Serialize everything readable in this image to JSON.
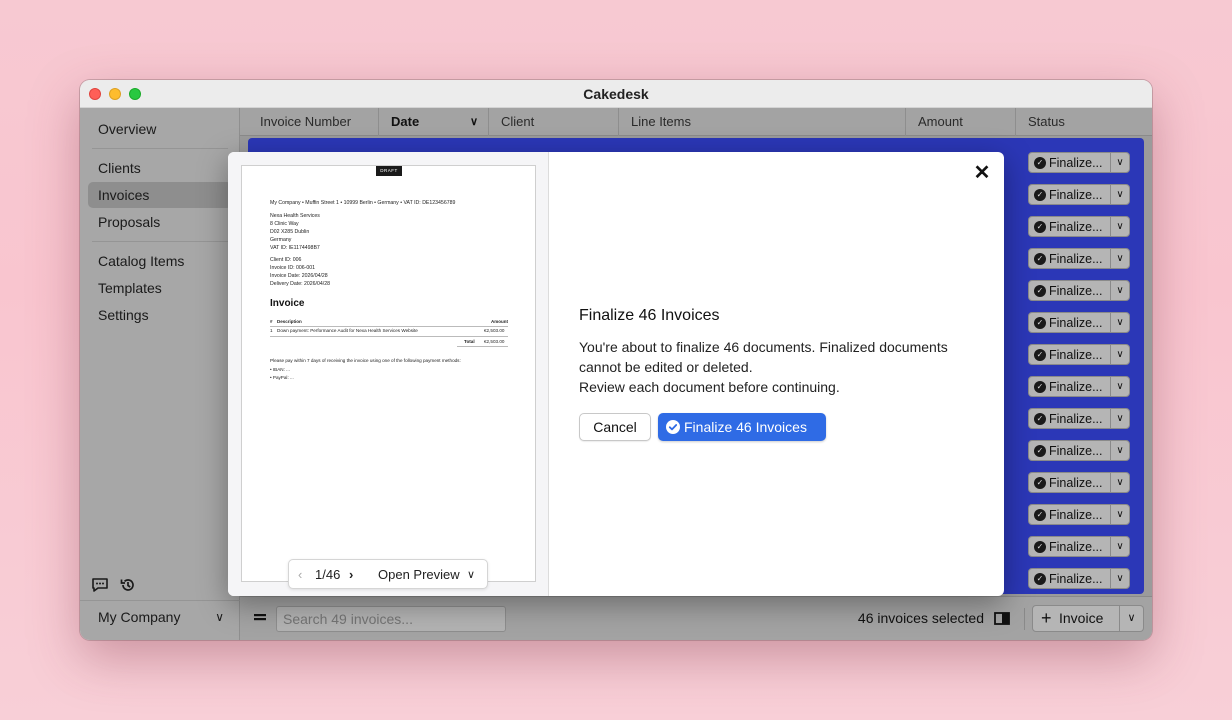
{
  "window": {
    "title": "Cakedesk"
  },
  "sidebar": {
    "items": [
      {
        "label": "Overview"
      },
      {
        "label": "Clients"
      },
      {
        "label": "Invoices"
      },
      {
        "label": "Proposals"
      },
      {
        "label": "Catalog Items"
      },
      {
        "label": "Templates"
      },
      {
        "label": "Settings"
      }
    ],
    "active": "Invoices",
    "company": "My Company"
  },
  "table": {
    "columns": [
      "Invoice Number",
      "Date",
      "Client",
      "Line Items",
      "Amount",
      "Status"
    ],
    "sorted_column": "Date",
    "status_label": "Finalize...",
    "visible_status_rows": 14
  },
  "bottombar": {
    "search_placeholder": "Search 49 invoices...",
    "selected_text": "46 invoices selected",
    "add_label": "Invoice"
  },
  "modal": {
    "title": "Finalize 46 Invoices",
    "body_line1": "You're about to finalize 46 documents. Finalized documents cannot be edited or deleted.",
    "body_line2": "Review each document before continuing.",
    "cancel_label": "Cancel",
    "confirm_label": "Finalize 46 Invoices",
    "close_label": "✕"
  },
  "preview": {
    "badge": "DRAFT",
    "sender_line": "My Company • Muffin Street 1 • 10999 Berlin • Germany • VAT ID: DE123456789",
    "recipient": [
      "Nexa Health Services",
      "8 Clinic Way",
      "D02 X285 Dublin",
      "Germany",
      "VAT ID: IE1174498B7"
    ],
    "meta": [
      "Client ID: 006",
      "Invoice ID: 006-001",
      "Invoice Date: 2026/04/28",
      "Delivery Date: 2026/04/28"
    ],
    "heading": "Invoice",
    "col_num": "#",
    "col_desc": "Description",
    "col_amount": "Amount",
    "line_num": "1",
    "line_desc": "Down payment: Performance Audit for Nexa Health Services Website",
    "line_amount": "€2,503.00",
    "total_label": "Total",
    "total_amount": "€2,503.00",
    "payment_note": "Please pay within 7 days of receiving the invoice using one of the following payment methods:",
    "payment_methods": [
      "• IBAN: ...",
      "• PayPal: ..."
    ],
    "pager": {
      "page": "1/46",
      "open_label": "Open Preview"
    }
  },
  "colors": {
    "selection": "#2b37b7",
    "accent": "#2f6be5"
  }
}
